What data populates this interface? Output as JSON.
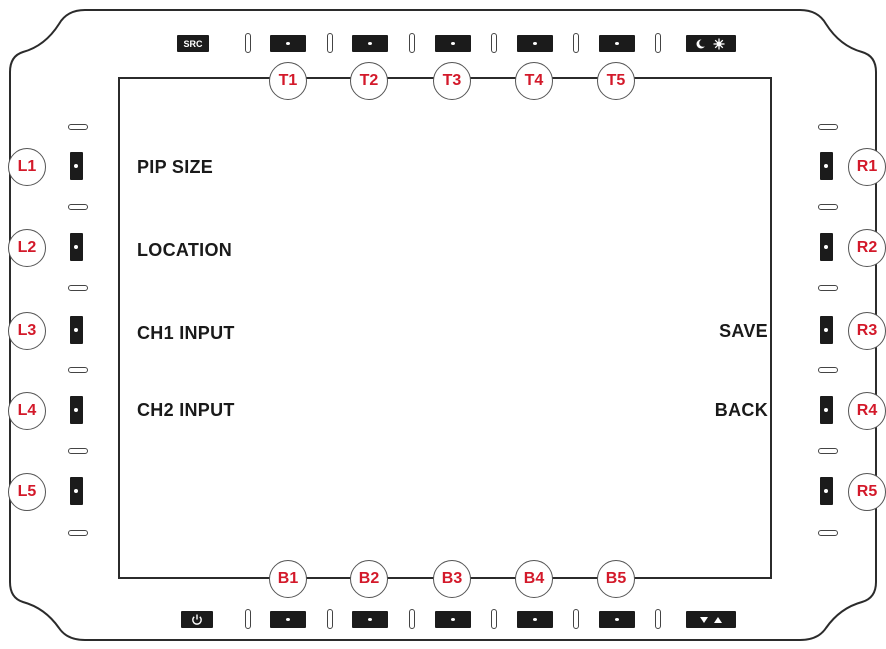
{
  "top_bar": {
    "src_label": "SRC",
    "callouts": [
      "T1",
      "T2",
      "T3",
      "T4",
      "T5"
    ],
    "brightness_icons": {
      "moon": "moon-icon",
      "sun": "sun-icon"
    }
  },
  "bottom_bar": {
    "callouts": [
      "B1",
      "B2",
      "B3",
      "B4",
      "B5"
    ],
    "power_icon": "power-icon",
    "arrow_icons": {
      "down": "down-arrow-icon",
      "up": "up-arrow-icon"
    }
  },
  "left_keys": {
    "callouts": [
      "L1",
      "L2",
      "L3",
      "L4",
      "L5"
    ]
  },
  "right_keys": {
    "callouts": [
      "R1",
      "R2",
      "R3",
      "R4",
      "R5"
    ]
  },
  "screen": {
    "left_labels": [
      "PIP SIZE",
      "LOCATION",
      "CH1 INPUT",
      "CH2 INPUT"
    ],
    "right_labels": {
      "r3": "SAVE",
      "r4": "BACK"
    }
  },
  "colors": {
    "callout_text": "#d3192a",
    "button": "#1b1b1b",
    "outline": "#2b2b2b"
  }
}
